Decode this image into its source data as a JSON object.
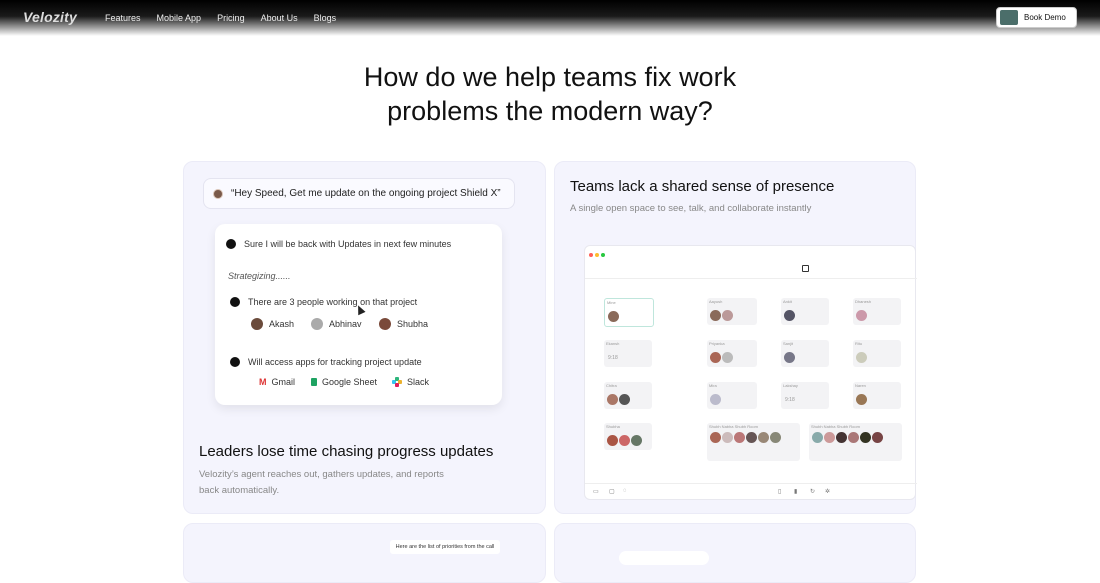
{
  "nav": {
    "logo": "Velozity",
    "links": [
      "Features",
      "Mobile App",
      "Pricing",
      "About Us",
      "Blogs"
    ],
    "cta": "Book Demo"
  },
  "hero": {
    "line1": "How do we help teams fix work",
    "line2": "problems the modern way?"
  },
  "card1": {
    "prompt": "“Hey Speed, Get me update on the ongoing project Shield X”",
    "reply1": "Sure I will be back with Updates in next few minutes",
    "status": "Strategizing......",
    "reply2": "There are 3 people working on that project",
    "people": [
      "Akash",
      "Abhinav",
      "Shubha"
    ],
    "reply3": "Will access apps for tracking project update",
    "apps": [
      "Gmail",
      "Google Sheet",
      "Slack"
    ],
    "title": "Leaders lose time chasing progress updates",
    "desc_line1": "Velozity’s agent reaches out, gathers updates, and reports",
    "desc_line2": "back automatically."
  },
  "card2": {
    "title": "Teams lack a shared sense of presence",
    "desc": "A single open space to see, talk, and collaborate instantly",
    "rooms": [
      {
        "label": "Mine",
        "time": ""
      },
      {
        "label": "Aayush",
        "time": ""
      },
      {
        "label": "Ankit",
        "time": ""
      },
      {
        "label": "Dhanesh",
        "time": ""
      },
      {
        "label": "Ekansh",
        "time": "9:18"
      },
      {
        "label": "Priyanka",
        "time": ""
      },
      {
        "label": "Sanjit",
        "time": ""
      },
      {
        "label": "Ritu",
        "time": ""
      },
      {
        "label": "Chitra",
        "time": ""
      },
      {
        "label": "Mira",
        "time": ""
      },
      {
        "label": "Lakshay",
        "time": "9:18"
      },
      {
        "label": "Naren",
        "time": ""
      },
      {
        "label": "Shubha",
        "time": ""
      },
      {
        "label": "Shubh Nabha Shubh Room",
        "time": ""
      },
      {
        "label": "Shubh Nabha Shubh Room",
        "time": ""
      }
    ]
  },
  "card3": {
    "popup": "Here are the list of priorities from the call"
  }
}
